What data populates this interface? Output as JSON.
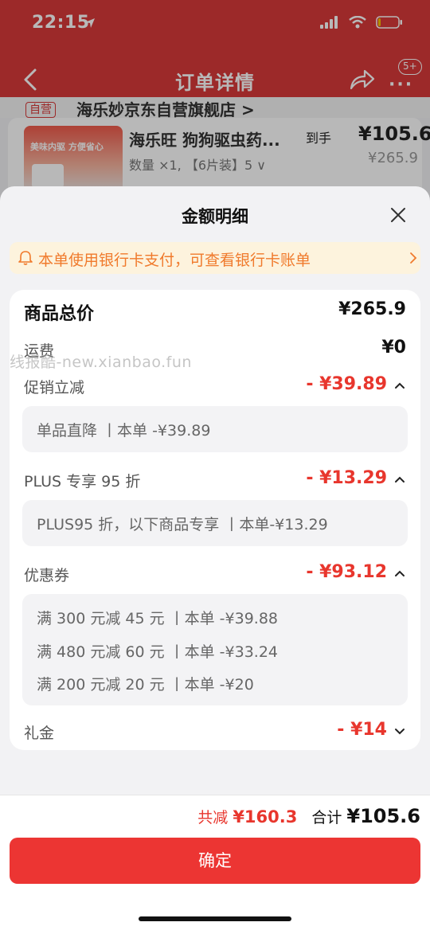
{
  "status_bar": {
    "time": "22:15"
  },
  "nav": {
    "title": "订单详情",
    "badge": "5+"
  },
  "store": {
    "tag": "自营",
    "name": "海乐妙京东自营旗舰店 >"
  },
  "product": {
    "name": "海乐旺 狗狗驱虫药...",
    "spec": "数量 ×1, 【6片装】5 ∨",
    "price_label": "到手",
    "price": "¥105.6",
    "original_price": "¥265.9",
    "thumb_text": "美味内驱 方便省心"
  },
  "sheet": {
    "title": "金额明细",
    "notice": "本单使用银行卡支付，可查看银行卡账单",
    "rows": {
      "total": {
        "label": "商品总价",
        "value": "¥265.9"
      },
      "shipping": {
        "label": "运费",
        "value": "¥0"
      },
      "promo": {
        "label": "促销立减",
        "value": "- ¥39.89",
        "details": [
          "单品直降 丨本单 -¥39.89"
        ]
      },
      "plus": {
        "label": "PLUS 专享 95 折",
        "value": "- ¥13.29",
        "details": [
          "PLUS95 折，以下商品专享 丨本单-¥13.29"
        ]
      },
      "coupon": {
        "label": "优惠券",
        "value": "- ¥93.12",
        "details": [
          "满 300 元减 45 元 丨本单 -¥39.88",
          "满 480 元减 60 元 丨本单 -¥33.24",
          "满 200 元减 20 元 丨本单 -¥20"
        ]
      },
      "gift": {
        "label": "礼金",
        "value": "- ¥14"
      }
    },
    "watermark": "线报酷-new.xianbao.fun"
  },
  "footer": {
    "discount_label": "共减",
    "discount_value": "¥160.3",
    "total_label": "合计",
    "total_value": "¥105.6",
    "confirm_label": "确定"
  },
  "colors": {
    "accent": "#ec3533",
    "red_text": "#e8362d",
    "notice_bg": "#fdf3dd",
    "notice_text": "#f07a2c"
  },
  "icons": [
    "location-arrow-icon",
    "signal-icon",
    "wifi-icon",
    "battery-icon",
    "back-icon",
    "share-icon",
    "more-icon",
    "close-icon",
    "bell-icon",
    "chevron-right-icon",
    "chevron-up-icon",
    "chevron-down-icon"
  ]
}
